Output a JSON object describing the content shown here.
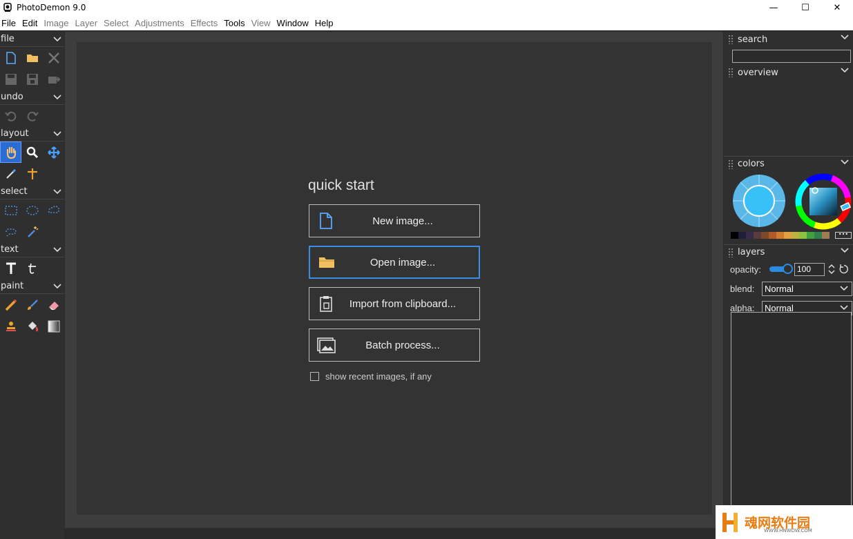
{
  "window": {
    "title": "PhotoDemon 9.0",
    "minimize": "—",
    "maximize": "☐",
    "close": "✕"
  },
  "menu": {
    "items": [
      {
        "label": "File",
        "dim": false
      },
      {
        "label": "Edit",
        "dim": false
      },
      {
        "label": "Image",
        "dim": true
      },
      {
        "label": "Layer",
        "dim": true
      },
      {
        "label": "Select",
        "dim": true
      },
      {
        "label": "Adjustments",
        "dim": true
      },
      {
        "label": "Effects",
        "dim": true
      },
      {
        "label": "Tools",
        "dim": false
      },
      {
        "label": "View",
        "dim": true
      },
      {
        "label": "Window",
        "dim": false
      },
      {
        "label": "Help",
        "dim": false
      }
    ]
  },
  "toolbox": {
    "file_label": "file",
    "undo_label": "undo",
    "layout_label": "layout",
    "select_label": "select",
    "text_label": "text",
    "paint_label": "paint"
  },
  "quick_start": {
    "title": "quick start",
    "new_image": "New image...",
    "open_image": "Open image...",
    "import_clipboard": "Import from clipboard...",
    "batch_process": "Batch process...",
    "show_recent": "show recent images, if any"
  },
  "right_panel": {
    "search_label": "search",
    "overview_label": "overview",
    "colors_label": "colors",
    "layers_label": "layers",
    "opacity_label": "opacity:",
    "opacity_value": "100",
    "blend_label": "blend:",
    "blend_value": "Normal",
    "alpha_label": "alpha:",
    "alpha_value": "Normal",
    "palette_colors": [
      "#000000",
      "#1e1e3a",
      "#3a2a4a",
      "#5a3a3a",
      "#7a4a2a",
      "#b05a2a",
      "#d07a30",
      "#e0a040",
      "#c0b040",
      "#90c040",
      "#40a040",
      "#308050",
      "#a07a50"
    ],
    "palette_more": "•••"
  },
  "watermark": {
    "text": "魂网软件园",
    "sub": "WWW.HNWDW.COM"
  }
}
